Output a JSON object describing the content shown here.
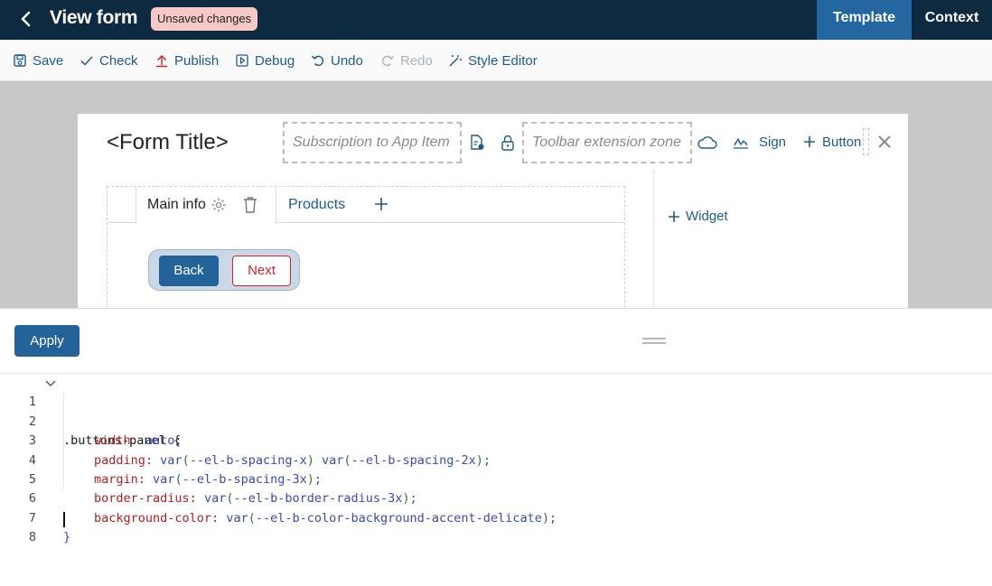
{
  "header": {
    "title": "View form",
    "badge": "Unsaved changes",
    "tabs": {
      "template": "Template",
      "context": "Context"
    }
  },
  "toolbar": {
    "save": "Save",
    "check": "Check",
    "publish": "Publish",
    "debug": "Debug",
    "undo": "Undo",
    "redo": "Redo",
    "style_editor": "Style Editor"
  },
  "form": {
    "title": "<Form Title>",
    "subscription_zone": "Subscription to App Item",
    "toolbar_zone": "Toolbar extension zone",
    "sign": "Sign",
    "add_button": "Button",
    "tabs": {
      "main": "Main info",
      "products": "Products"
    },
    "buttons": {
      "back": "Back",
      "next": "Next"
    },
    "widget": "Widget"
  },
  "editor": {
    "apply": "Apply",
    "line_numbers": [
      "1",
      "2",
      "3",
      "4",
      "5",
      "6",
      "7",
      "8"
    ],
    "code": {
      "l1": ".buttons-panel {",
      "l2_prop": "width:",
      "l2_val": " auto;",
      "l3_prop": "padding:",
      "l3_val": " var(--el-b-spacing-x) var(--el-b-spacing-2x);",
      "l4_prop": "margin:",
      "l4_val": " var(--el-b-spacing-3x);",
      "l5_prop": "border-radius:",
      "l5_val": " var(--el-b-border-radius-3x);",
      "l6_prop": "background-color:",
      "l6_val": " var(--el-b-color-background-accent-delicate);",
      "l7": "}"
    }
  },
  "colors": {
    "header_bg": "#0e2a40",
    "accent": "#24629a",
    "badge_bg": "#f6c9c6",
    "next_red": "#d2252d"
  }
}
